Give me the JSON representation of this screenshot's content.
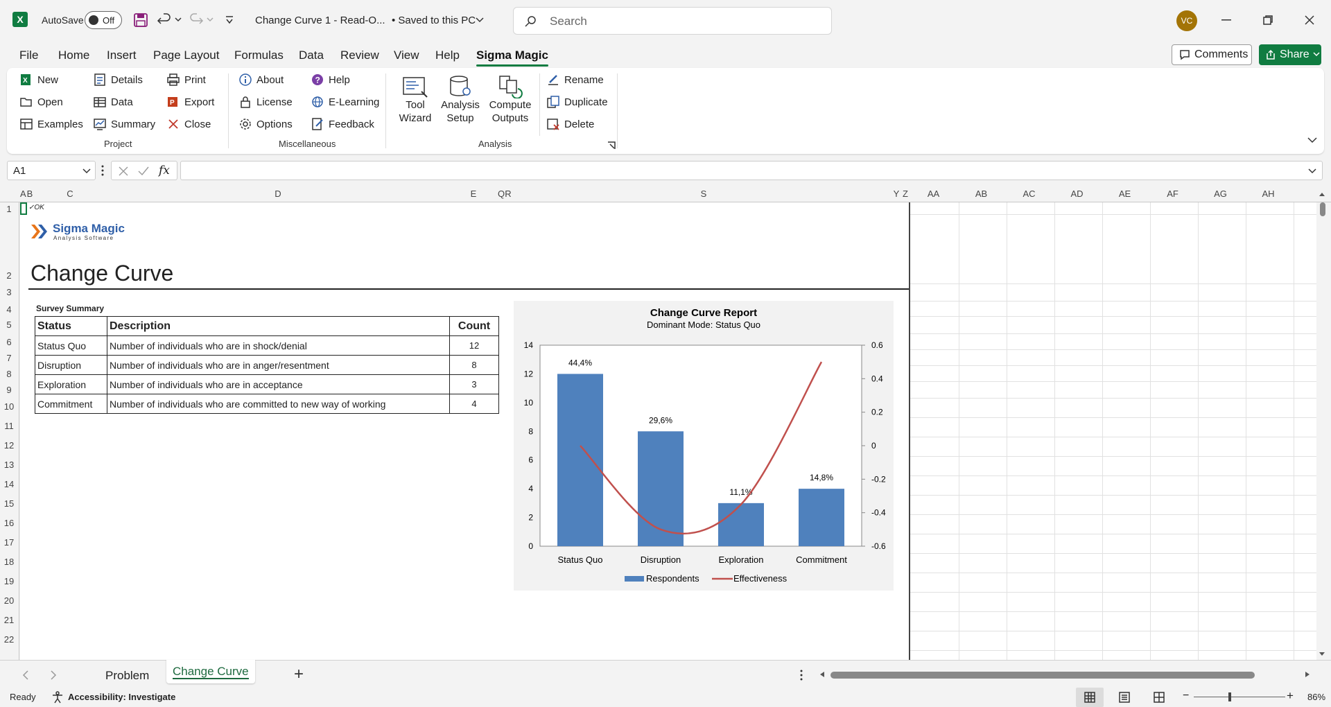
{
  "app": {
    "logo_letter": "X",
    "autosave_label": "AutoSave",
    "autosave_state": "Off",
    "doc_title": "Change Curve 1  -  Read-O...",
    "saved_status": "• Saved to this PC",
    "search_placeholder": "Search",
    "user_initials": "VC",
    "accent": "#107c41",
    "avatar_color": "#a37406"
  },
  "tabs": [
    "File",
    "Home",
    "Insert",
    "Page Layout",
    "Formulas",
    "Data",
    "Review",
    "View",
    "Help",
    "Sigma Magic"
  ],
  "comments_label": "Comments",
  "share_label": "Share",
  "ribbon": {
    "project": {
      "new": "New",
      "open": "Open",
      "examples": "Examples",
      "details": "Details",
      "data": "Data",
      "summary": "Summary",
      "print": "Print",
      "export": "Export",
      "close": "Close",
      "label": "Project"
    },
    "misc": {
      "about": "About",
      "license": "License",
      "options": "Options",
      "help": "Help",
      "elearning": "E-Learning",
      "feedback": "Feedback",
      "label": "Miscellaneous"
    },
    "analysis": {
      "tool_wizard_1": "Tool",
      "tool_wizard_2": "Wizard",
      "setup_1": "Analysis",
      "setup_2": "Setup",
      "compute_1": "Compute",
      "compute_2": "Outputs",
      "rename": "Rename",
      "duplicate": "Duplicate",
      "delete": "Delete",
      "label": "Analysis"
    }
  },
  "formula_bar": {
    "name_box": "A1",
    "fx": "fx",
    "formula": ""
  },
  "columns": [
    "A",
    "B",
    "C",
    "D",
    "E",
    "Q",
    "R",
    "S",
    "Y",
    "Z",
    "AA",
    "AB",
    "AC",
    "AD",
    "AE",
    "AF",
    "AG",
    "AH"
  ],
  "rows": [
    "1",
    "2",
    "3",
    "4",
    "5",
    "6",
    "7",
    "8",
    "9",
    "10",
    "11",
    "12",
    "13",
    "14",
    "15",
    "16",
    "17",
    "18",
    "19",
    "20",
    "21",
    "22"
  ],
  "sheet": {
    "ok_flag": "✓OK",
    "brand_name": "Sigma Magic",
    "brand_sub": "Analysis Software",
    "title": "Change Curve",
    "summary_caption": "Survey Summary",
    "table_headers": [
      "Status",
      "Description",
      "Count"
    ],
    "table_rows": [
      [
        "Status Quo",
        "Number of individuals who are in shock/denial",
        "12"
      ],
      [
        "Disruption",
        "Number of individuals who are in anger/resentment",
        "8"
      ],
      [
        "Exploration",
        "Number of individuals who are in acceptance",
        "3"
      ],
      [
        "Commitment",
        "Number of individuals who are committed to new way of working",
        "4"
      ]
    ]
  },
  "chart_data": {
    "type": "bar",
    "title": "Change Curve Report",
    "subtitle": "Dominant Mode: Status Quo",
    "categories": [
      "Status Quo",
      "Disruption",
      "Exploration",
      "Commitment"
    ],
    "series": [
      {
        "name": "Respondents",
        "type": "bar",
        "values": [
          12,
          8,
          3,
          4
        ],
        "labels": [
          "44,4%",
          "29,6%",
          "11,1%",
          "14,8%"
        ],
        "color": "#4f81bd",
        "axis": "left"
      },
      {
        "name": "Effectiveness",
        "type": "line",
        "values": [
          0,
          -0.5,
          -0.35,
          0.5
        ],
        "color": "#c0504d",
        "axis": "right"
      }
    ],
    "ylim": [
      0,
      14
    ],
    "yticks": [
      "0",
      "2",
      "4",
      "6",
      "8",
      "10",
      "12",
      "14"
    ],
    "y2lim": [
      -0.6,
      0.6
    ],
    "y2ticks": [
      "-0.6",
      "-0.4",
      "-0.2",
      "0",
      "0.2",
      "0.4",
      "0.6"
    ],
    "legend": "bottom",
    "grid": false
  },
  "sheet_tabs": [
    "Problem",
    "Change Curve"
  ],
  "active_sheet": "Change Curve",
  "status": {
    "ready": "Ready",
    "accessibility": "Accessibility: Investigate",
    "zoom": "86%"
  }
}
